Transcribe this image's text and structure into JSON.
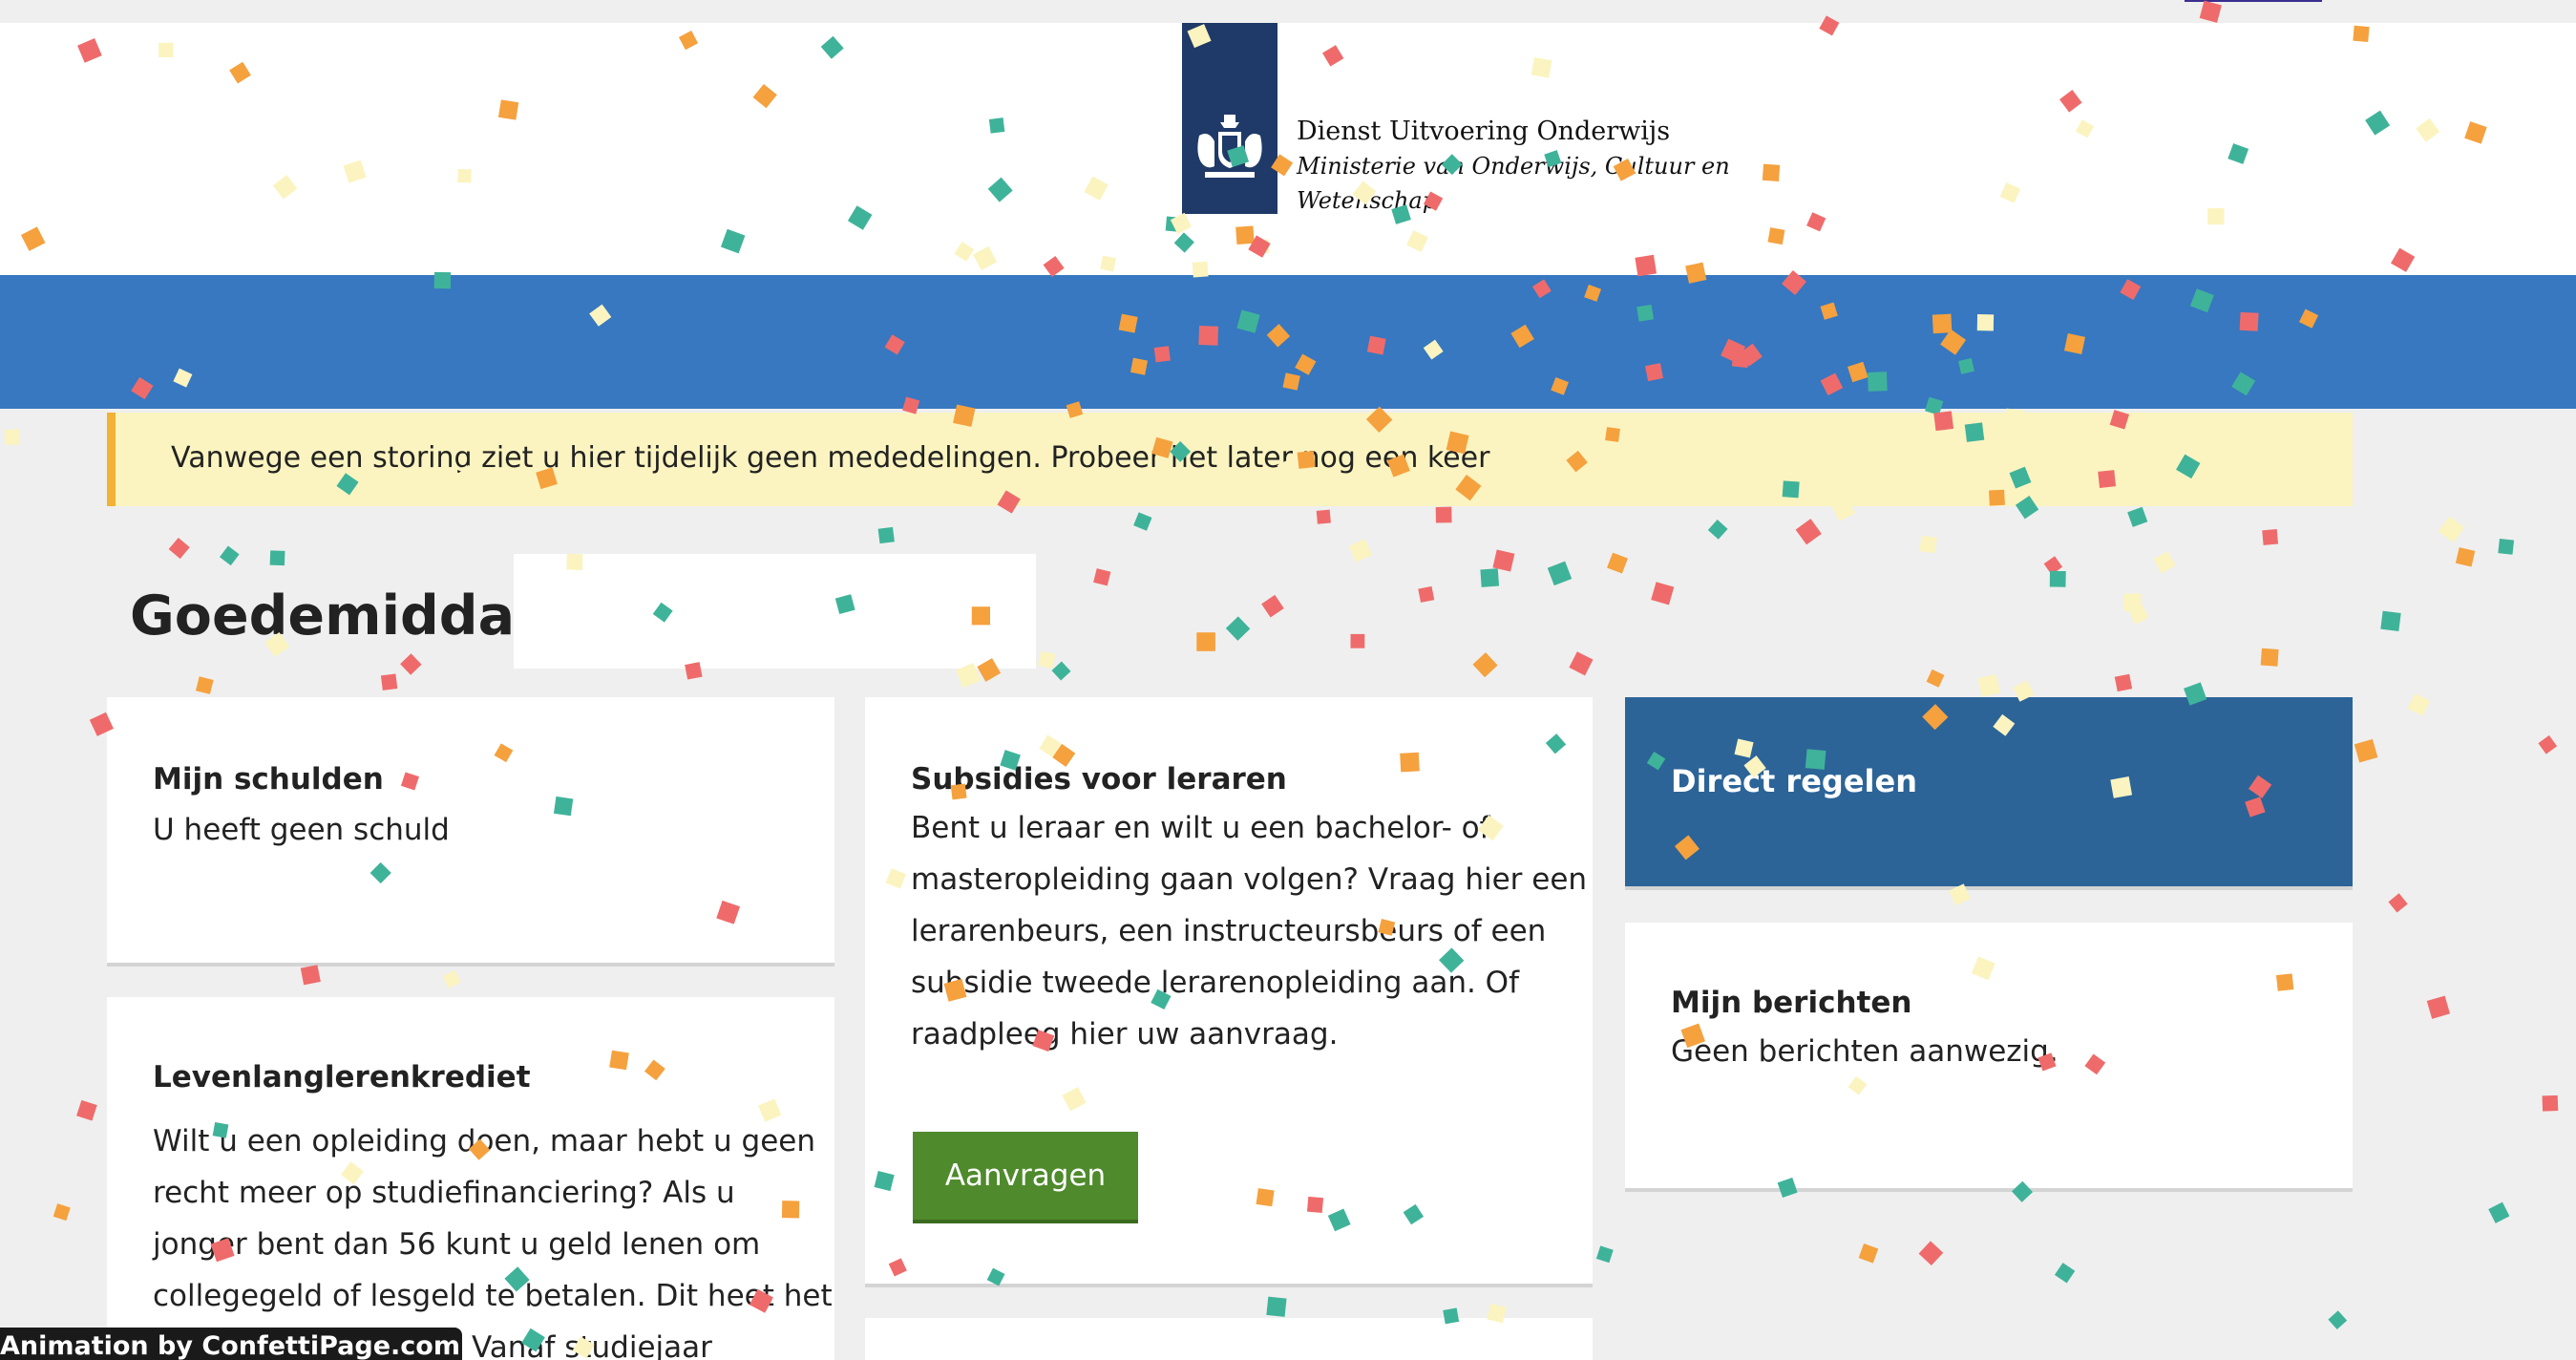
{
  "header": {
    "org_name": "Dienst Uitvoering Onderwijs",
    "ministry_line1": "Ministerie van Onderwijs, Cultuur en",
    "ministry_line2": "Wetenschap"
  },
  "notice": {
    "text": "Vanwege een storing ziet u hier tijdelijk geen mededelingen. Probeer het later nog een keer"
  },
  "greeting": "Goedemiddag,",
  "cards": {
    "schulden": {
      "title": "Mijn schulden",
      "text": "U heeft geen schuld"
    },
    "levenlanglerenkrediet": {
      "title": "Levenlanglerenkrediet",
      "lines": [
        "Wilt u een opleiding doen, maar hebt u geen",
        "recht meer op studiefinanciering? Als u",
        "jonger bent dan 56 kunt u geld lenen om",
        "collegegeld of lesgeld te betalen. Dit heet het",
        "Vanaf studiejaar"
      ]
    },
    "subsidies": {
      "title": "Subsidies voor leraren",
      "lines": [
        "Bent u leraar en wilt u een bachelor- of",
        "masteropleiding gaan volgen? Vraag hier een",
        "lerarenbeurs, een instructeursbeurs of een",
        "subsidie tweede lerarenopleiding aan. Of",
        "raadpleeg hier uw aanvraag."
      ],
      "button_label": "Aanvragen"
    },
    "direct": {
      "title": "Direct regelen"
    },
    "berichten": {
      "title": "Mijn berichten",
      "text": "Geen berichten aanwezig."
    }
  },
  "credit": "Animation by ConfettiPage.com",
  "colors": {
    "brand_blue": "#3778c0",
    "logo_navy": "#1f3a68",
    "direct_card": "#2c6498",
    "button_green": "#4f8a2c",
    "notice_bg": "#fbf4c0",
    "notice_border": "#f2b236",
    "confetti": [
      "#ef6b6b",
      "#3fb39a",
      "#f5a13e",
      "#fbf4c0"
    ]
  }
}
